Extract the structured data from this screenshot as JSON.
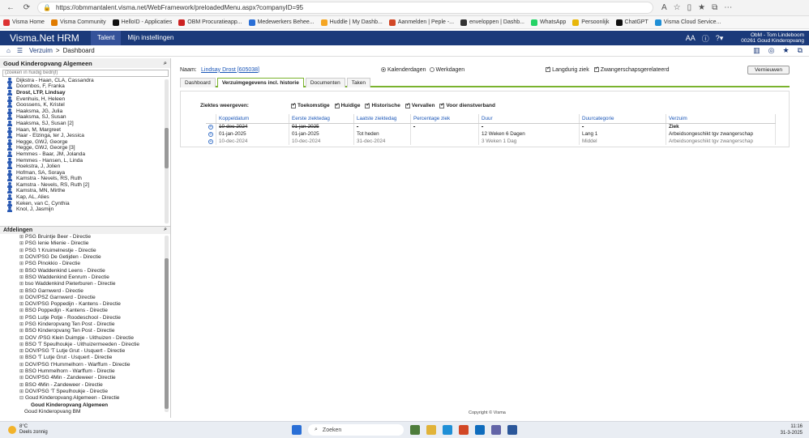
{
  "browser": {
    "url": "https://obmmantalent.visma.net/WebFramework/preloadedMenu.aspx?companyID=95",
    "bookmarks": [
      "Visma Home",
      "Visma Community",
      "HelloID - Applicaties",
      "OBM Procuratieapp...",
      "Medewerkers Behee...",
      "Huddle | My Dashb...",
      "Aanmelden | Peple -...",
      "enveloppen | Dashb...",
      "WhatsApp",
      "Persoonlijk",
      "ChatGPT",
      "Visma Cloud Service..."
    ]
  },
  "header": {
    "app_title": "Visma.Net HRM",
    "tabs": [
      "Talent",
      "Mijn instellingen"
    ],
    "font_size_label": "AA",
    "user_line1": "ObM - Tom Lindeboom",
    "user_line2": "00261 Goud Kinderopvang"
  },
  "breadcrumb": {
    "items": [
      "Verzuim",
      "Dashboard"
    ],
    "separator": ">"
  },
  "left_panel": {
    "title": "Goud Kinderopvang Algemeen",
    "search_placeholder": "(zoeken in huidig bedrijf)",
    "employees": [
      "Dijkstra - Haan, CLA, Cassandra",
      "Doornbos, F, Franka",
      "Drost, LTP, Lindsay",
      "Evenhuis, H, Heleen",
      "Goossens, K, Kristel",
      "Haaksma, JG, Julia",
      "Haaksma, SJ, Susan",
      "Haaksma, SJ, Susan [2]",
      "Haan, M, Margreet",
      "Haar - Elzinga, ter J, Jessica",
      "Hegge, GWJ, George",
      "Hegge, GWJ, George [3]",
      "Hemmes - Baar, JM, Jolanda",
      "Hemmes - Hansen, L, Linda",
      "Hoekstra, J, Jolien",
      "Hofman, SA, Soraya",
      "Kamstra - Nevels, RS, Ruth",
      "Kamstra - Nevels, RS, Ruth [2]",
      "Kamstra, MN, Mirthe",
      "Kap, AL, Alies",
      "Keken, van C, Cynthia",
      "Knol, J, Jasmijn"
    ],
    "selected_employee_index": 2,
    "afdelingen_title": "Afdelingen",
    "afdelingen": [
      "PSG Bruintje Beer - Directie",
      "PSG Ienie Mienie - Directie",
      "PSG 't Kruimelnestje - Directie",
      "DOV/PSG De Getijden - Directie",
      "PSG Pinokkio - Directie",
      "BSO Waddenkind Leens - Directie",
      "BSO Waddenkind Eenrum - Directie",
      "bso Waddenkind Pieterburen - Directie",
      "BSO Garnwerd - Directie",
      "DOV/PSZ Garnwerd - Directie",
      "DOV/PSG Poppedijn - Kantens - Directie",
      "BSO Poppedijn - Kantens - Directie",
      "PSG Lutje Potje - Roodeschool - Directie",
      "PSG Kinderopvang Ten Post - Directie",
      "BSO Kinderopvang Ten Post - Directie",
      "DOV /PSG Klein Duimpje - Uithuizen - Directie",
      "BSO 'T Speulhoukje - Uithuizermeeden - Directie",
      "DOV/PSG 'T Lutje Grut - Usquert - Directie",
      "BSO 'T Lutje Grut - Usquert - Directie",
      "DOV/PSG t'Hummelhorn - Warffum - Directie",
      "BSO Hummelhorn - Warffum - Directie",
      "DOV/PSG 4Min - Zandeweer - Directie",
      "BSO 4Min - Zandeweer - Directie",
      "DOV/PSG 'T Speulhoukje - Directie",
      "Goud Kinderopvang Algemeen - Directie"
    ],
    "afd_selected": "Goud Kinderopvang Algemeen",
    "afd_last": "Goud Kinderopvang BM"
  },
  "main": {
    "name_label": "Naam:",
    "employee_name": "Lindsay Drost [605038]",
    "radio_options": [
      "Kalenderdagen",
      "Werkdagen"
    ],
    "radio_selected": 0,
    "checkboxes": [
      {
        "label": "Langdurig ziek",
        "checked": true
      },
      {
        "label": "Zwangerschapsgerelateerd",
        "checked": true
      }
    ],
    "refresh_button": "Vernieuwen",
    "tabs": [
      "Dashboard",
      "Verzuimgegevens incl. historie",
      "Documenten",
      "Taken"
    ],
    "active_tab": 1,
    "filter_label": "Ziektes weergeven:",
    "filters": [
      {
        "label": "Toekomstige",
        "checked": true
      },
      {
        "label": "Huidige",
        "checked": true
      },
      {
        "label": "Historische",
        "checked": true
      },
      {
        "label": "Vervallen",
        "checked": true
      },
      {
        "label": "Voor dienstverband",
        "checked": true
      }
    ],
    "columns": [
      "Koppeldatum",
      "Eerste ziektedag",
      "Laatste ziektedag",
      "Percentage ziek",
      "Duur",
      "Duurcategorie",
      "Verzuim"
    ],
    "rows": [
      [
        "10-dec-2024",
        "01-jan-2025",
        "-",
        "-",
        "-",
        "-",
        "Ziek"
      ],
      [
        "01-jan-2025",
        "01-jan-2025",
        "Tot heden",
        "",
        "12 Weken 6 Dagen",
        "Lang 1",
        "Arbeidsongeschikt tgv zwangerschap"
      ],
      [
        "10-dec-2024",
        "10-dec-2024",
        "31-dec-2024",
        "",
        "3 Weken 1 Dag",
        "Middel",
        "Arbeidsongeschikt tgv zwangerschap"
      ]
    ],
    "copyright": "Copyright © Visma"
  },
  "taskbar": {
    "temperature": "8°C",
    "weather": "Deels zonnig",
    "search": "Zoeken",
    "time": "11:16",
    "date": "31-3-2025"
  }
}
